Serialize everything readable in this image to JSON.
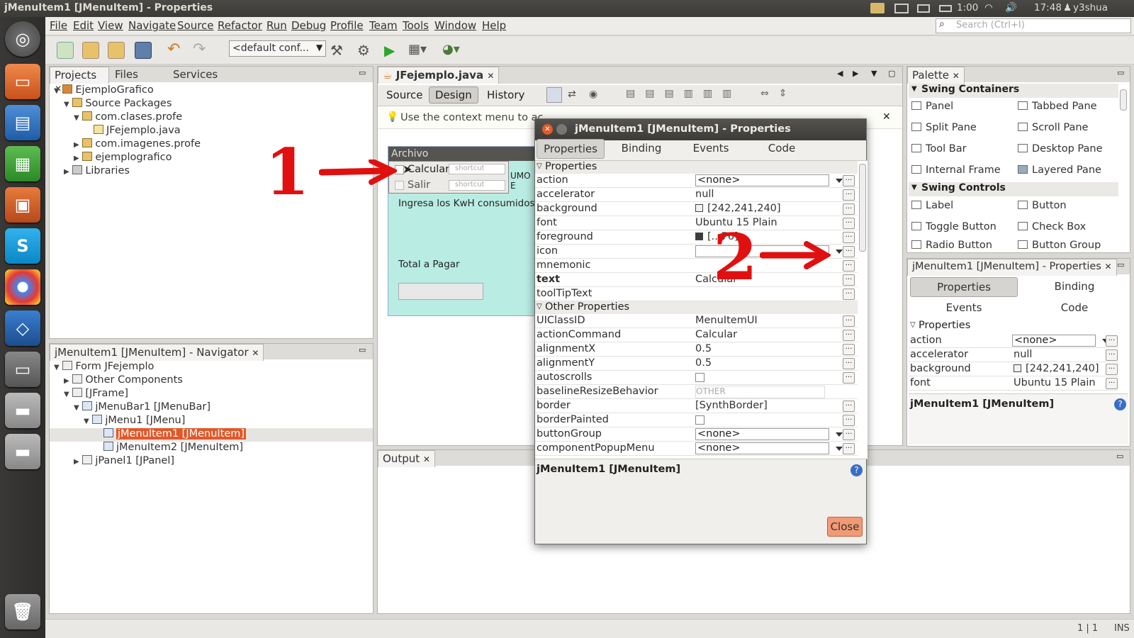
{
  "topbar": {
    "title": "jMenuItem1 [JMenuItem] - Properties",
    "battery": "1:00",
    "time": "17:48",
    "user": "y3shua"
  },
  "menubar": {
    "items": [
      "File",
      "Edit",
      "View",
      "Navigate",
      "Source",
      "Refactor",
      "Run",
      "Debug",
      "Profile",
      "Team",
      "Tools",
      "Window",
      "Help"
    ],
    "search_placeholder": "Search (Ctrl+I)"
  },
  "toolbar": {
    "config": "<default conf..."
  },
  "projects": {
    "tabs": [
      "Projects",
      "Files",
      "Services"
    ],
    "tree": [
      "EjemploGrafico",
      "Source Packages",
      "com.clases.profe",
      "JFejemplo.java",
      "com.imagenes.profe",
      "ejemplografico",
      "Libraries"
    ]
  },
  "navigator": {
    "title": "jMenuItem1 [JMenuItem] - Navigator",
    "tree": [
      "Form JFejemplo",
      "Other Components",
      "[JFrame]",
      "jMenuBar1 [JMenuBar]",
      "jMenu1 [JMenu]",
      "jMenuItem1 [JMenuItem]",
      "jMenuItem2 [JMenuItem]",
      "jPanel1 [JPanel]"
    ]
  },
  "editor": {
    "tab": "JFejemplo.java",
    "views": [
      "Source",
      "Design",
      "History"
    ],
    "hint": "Use the context menu to ac",
    "form": {
      "menu": "Archivo",
      "items": [
        "Calcular",
        "Salir"
      ],
      "shortcut": "shortcut",
      "label1": "Ingresa los KwH consumidos",
      "label2": "Total a Pagar",
      "partial": "UMO E"
    }
  },
  "output": {
    "tab": "Output"
  },
  "dialog": {
    "title": "jMenuItem1 [JMenuItem] - Properties",
    "tabs": [
      "Properties",
      "Binding",
      "Events",
      "Code"
    ],
    "section1": "Properties",
    "section2": "Other Properties",
    "props": [
      {
        "name": "action",
        "value": "<none>",
        "kind": "combo"
      },
      {
        "name": "accelerator",
        "value": "null"
      },
      {
        "name": "background",
        "value": "[242,241,240]",
        "kind": "swatch",
        "color": "#f2f1f0"
      },
      {
        "name": "font",
        "value": "Ubuntu 15 Plain"
      },
      {
        "name": "foreground",
        "value": "[...76]",
        "kind": "swatch",
        "color": "#3c3c3c"
      },
      {
        "name": "icon",
        "value": "",
        "kind": "combo"
      },
      {
        "name": "mnemonic",
        "value": ""
      },
      {
        "name": "text",
        "value": "Calcular",
        "bold": true
      },
      {
        "name": "toolTipText",
        "value": ""
      }
    ],
    "other": [
      {
        "name": "UIClassID",
        "value": "MenuItemUI"
      },
      {
        "name": "actionCommand",
        "value": "Calcular"
      },
      {
        "name": "alignmentX",
        "value": "0.5"
      },
      {
        "name": "alignmentY",
        "value": "0.5"
      },
      {
        "name": "autoscrolls",
        "value": "",
        "kind": "check"
      },
      {
        "name": "baselineResizeBehavior",
        "value": "OTHER",
        "kind": "disabled"
      },
      {
        "name": "border",
        "value": "[SynthBorder]"
      },
      {
        "name": "borderPainted",
        "value": "",
        "kind": "check"
      },
      {
        "name": "buttonGroup",
        "value": "<none>",
        "kind": "combo"
      },
      {
        "name": "componentPopupMenu",
        "value": "<none>",
        "kind": "combo"
      }
    ],
    "footer": "jMenuItem1 [JMenuItem]",
    "close": "Close"
  },
  "palette": {
    "tab": "Palette",
    "cat1": "Swing Containers",
    "containers": [
      "Panel",
      "Tabbed Pane",
      "Split Pane",
      "Scroll Pane",
      "Tool Bar",
      "Desktop Pane",
      "Internal Frame",
      "Layered Pane"
    ],
    "cat2": "Swing Controls",
    "controls": [
      "Label",
      "Button",
      "Toggle Button",
      "Check Box",
      "Radio Button",
      "Button Group"
    ]
  },
  "rprops": {
    "title": "jMenuItem1 [JMenuItem] - Properties",
    "tabs": [
      "Properties",
      "Binding",
      "Events",
      "Code"
    ],
    "section": "Properties",
    "props": [
      {
        "name": "action",
        "value": "<none>"
      },
      {
        "name": "accelerator",
        "value": "null"
      },
      {
        "name": "background",
        "value": "[242,241,240]"
      },
      {
        "name": "font",
        "value": "Ubuntu 15 Plain"
      }
    ],
    "footer": "jMenuItem1 [JMenuItem]"
  },
  "status": {
    "pos": "1 | 1",
    "mode": "INS"
  },
  "annotations": {
    "one": "1",
    "two": "2"
  }
}
